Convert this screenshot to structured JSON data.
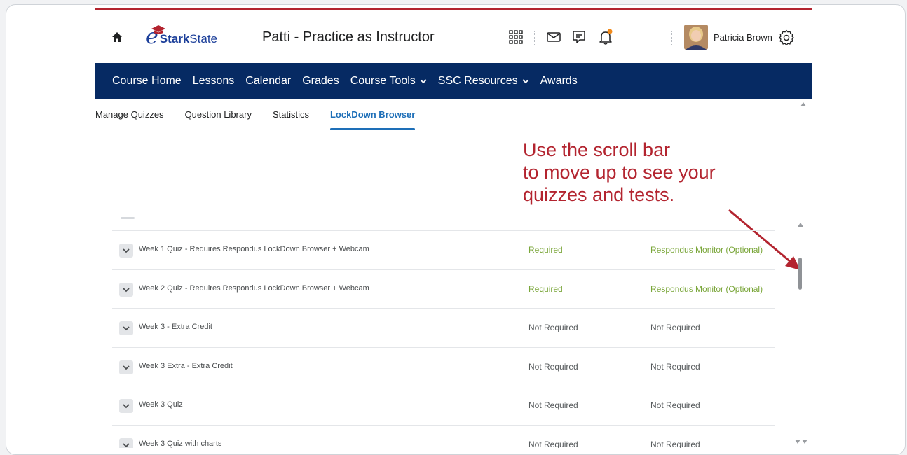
{
  "header": {
    "logo_text_bold": "Stark",
    "logo_text_light": "State",
    "logo_e": "e",
    "course_title": "Patti - Practice as Instructor",
    "user_name": "Patricia Brown",
    "icons": [
      "home-icon",
      "waffle-grid-icon",
      "mail-icon",
      "chat-icon",
      "bell-icon",
      "gear-icon"
    ],
    "accent_color": "#b3242f",
    "logo_color": "#1c3f9a",
    "notification_dot_color": "#f08a1c"
  },
  "navbar": {
    "background": "#062a63",
    "items": [
      {
        "label": "Course Home",
        "dropdown": false
      },
      {
        "label": "Lessons",
        "dropdown": false
      },
      {
        "label": "Calendar",
        "dropdown": false
      },
      {
        "label": "Grades",
        "dropdown": false
      },
      {
        "label": "Course Tools",
        "dropdown": true
      },
      {
        "label": "SSC Resources",
        "dropdown": true
      },
      {
        "label": "Awards",
        "dropdown": false
      }
    ]
  },
  "subtabs": {
    "items": [
      {
        "label": "Manage Quizzes",
        "active": false
      },
      {
        "label": "Question Library",
        "active": false
      },
      {
        "label": "Statistics",
        "active": false
      },
      {
        "label": "LockDown Browser",
        "active": true
      }
    ],
    "active_color": "#1e6fb8"
  },
  "annotation": {
    "lines": [
      "Use the scroll bar",
      "to move up to see your",
      "quizzes and tests."
    ],
    "color": "#b3242f"
  },
  "quizzes": [
    {
      "title": "Week 1 Quiz - Requires Respondus LockDown Browser + Webcam",
      "lockdown": "Required",
      "monitor": "Respondus Monitor (Optional)",
      "status": "green"
    },
    {
      "title": "Week 2 Quiz - Requires Respondus LockDown Browser + Webcam",
      "lockdown": "Required",
      "monitor": "Respondus Monitor (Optional)",
      "status": "green"
    },
    {
      "title": "Week 3 - Extra Credit",
      "lockdown": "Not Required",
      "monitor": "Not Required",
      "status": "gray"
    },
    {
      "title": "Week 3 Extra - Extra Credit",
      "lockdown": "Not Required",
      "monitor": "Not Required",
      "status": "gray"
    },
    {
      "title": "Week 3 Quiz",
      "lockdown": "Not Required",
      "monitor": "Not Required",
      "status": "gray"
    },
    {
      "title": "Week 3 Quiz with charts",
      "lockdown": "Not Required",
      "monitor": "Not Required",
      "status": "gray"
    }
  ],
  "status_colors": {
    "green": "#7aa63a",
    "gray": "#565a5c"
  }
}
